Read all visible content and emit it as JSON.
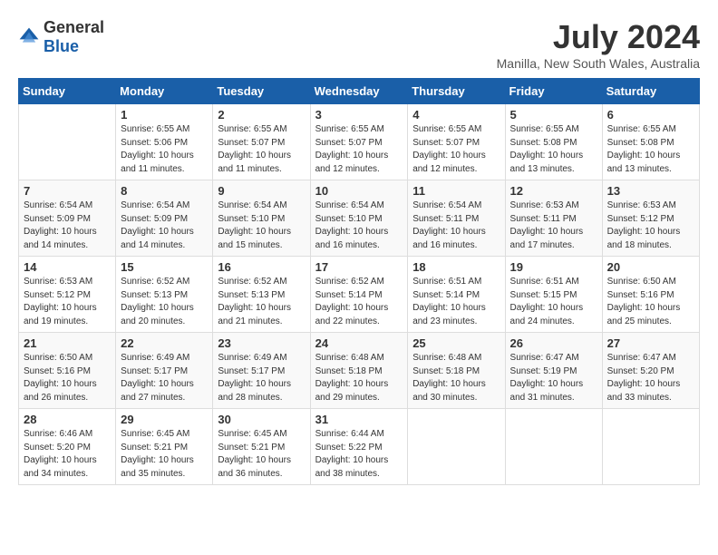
{
  "logo": {
    "general": "General",
    "blue": "Blue"
  },
  "title": {
    "month": "July 2024",
    "location": "Manilla, New South Wales, Australia"
  },
  "days_of_week": [
    "Sunday",
    "Monday",
    "Tuesday",
    "Wednesday",
    "Thursday",
    "Friday",
    "Saturday"
  ],
  "weeks": [
    [
      {
        "day": "",
        "content": ""
      },
      {
        "day": "1",
        "content": "Sunrise: 6:55 AM\nSunset: 5:06 PM\nDaylight: 10 hours\nand 11 minutes."
      },
      {
        "day": "2",
        "content": "Sunrise: 6:55 AM\nSunset: 5:07 PM\nDaylight: 10 hours\nand 11 minutes."
      },
      {
        "day": "3",
        "content": "Sunrise: 6:55 AM\nSunset: 5:07 PM\nDaylight: 10 hours\nand 12 minutes."
      },
      {
        "day": "4",
        "content": "Sunrise: 6:55 AM\nSunset: 5:07 PM\nDaylight: 10 hours\nand 12 minutes."
      },
      {
        "day": "5",
        "content": "Sunrise: 6:55 AM\nSunset: 5:08 PM\nDaylight: 10 hours\nand 13 minutes."
      },
      {
        "day": "6",
        "content": "Sunrise: 6:55 AM\nSunset: 5:08 PM\nDaylight: 10 hours\nand 13 minutes."
      }
    ],
    [
      {
        "day": "7",
        "content": "Sunrise: 6:54 AM\nSunset: 5:09 PM\nDaylight: 10 hours\nand 14 minutes."
      },
      {
        "day": "8",
        "content": "Sunrise: 6:54 AM\nSunset: 5:09 PM\nDaylight: 10 hours\nand 14 minutes."
      },
      {
        "day": "9",
        "content": "Sunrise: 6:54 AM\nSunset: 5:10 PM\nDaylight: 10 hours\nand 15 minutes."
      },
      {
        "day": "10",
        "content": "Sunrise: 6:54 AM\nSunset: 5:10 PM\nDaylight: 10 hours\nand 16 minutes."
      },
      {
        "day": "11",
        "content": "Sunrise: 6:54 AM\nSunset: 5:11 PM\nDaylight: 10 hours\nand 16 minutes."
      },
      {
        "day": "12",
        "content": "Sunrise: 6:53 AM\nSunset: 5:11 PM\nDaylight: 10 hours\nand 17 minutes."
      },
      {
        "day": "13",
        "content": "Sunrise: 6:53 AM\nSunset: 5:12 PM\nDaylight: 10 hours\nand 18 minutes."
      }
    ],
    [
      {
        "day": "14",
        "content": "Sunrise: 6:53 AM\nSunset: 5:12 PM\nDaylight: 10 hours\nand 19 minutes."
      },
      {
        "day": "15",
        "content": "Sunrise: 6:52 AM\nSunset: 5:13 PM\nDaylight: 10 hours\nand 20 minutes."
      },
      {
        "day": "16",
        "content": "Sunrise: 6:52 AM\nSunset: 5:13 PM\nDaylight: 10 hours\nand 21 minutes."
      },
      {
        "day": "17",
        "content": "Sunrise: 6:52 AM\nSunset: 5:14 PM\nDaylight: 10 hours\nand 22 minutes."
      },
      {
        "day": "18",
        "content": "Sunrise: 6:51 AM\nSunset: 5:14 PM\nDaylight: 10 hours\nand 23 minutes."
      },
      {
        "day": "19",
        "content": "Sunrise: 6:51 AM\nSunset: 5:15 PM\nDaylight: 10 hours\nand 24 minutes."
      },
      {
        "day": "20",
        "content": "Sunrise: 6:50 AM\nSunset: 5:16 PM\nDaylight: 10 hours\nand 25 minutes."
      }
    ],
    [
      {
        "day": "21",
        "content": "Sunrise: 6:50 AM\nSunset: 5:16 PM\nDaylight: 10 hours\nand 26 minutes."
      },
      {
        "day": "22",
        "content": "Sunrise: 6:49 AM\nSunset: 5:17 PM\nDaylight: 10 hours\nand 27 minutes."
      },
      {
        "day": "23",
        "content": "Sunrise: 6:49 AM\nSunset: 5:17 PM\nDaylight: 10 hours\nand 28 minutes."
      },
      {
        "day": "24",
        "content": "Sunrise: 6:48 AM\nSunset: 5:18 PM\nDaylight: 10 hours\nand 29 minutes."
      },
      {
        "day": "25",
        "content": "Sunrise: 6:48 AM\nSunset: 5:18 PM\nDaylight: 10 hours\nand 30 minutes."
      },
      {
        "day": "26",
        "content": "Sunrise: 6:47 AM\nSunset: 5:19 PM\nDaylight: 10 hours\nand 31 minutes."
      },
      {
        "day": "27",
        "content": "Sunrise: 6:47 AM\nSunset: 5:20 PM\nDaylight: 10 hours\nand 33 minutes."
      }
    ],
    [
      {
        "day": "28",
        "content": "Sunrise: 6:46 AM\nSunset: 5:20 PM\nDaylight: 10 hours\nand 34 minutes."
      },
      {
        "day": "29",
        "content": "Sunrise: 6:45 AM\nSunset: 5:21 PM\nDaylight: 10 hours\nand 35 minutes."
      },
      {
        "day": "30",
        "content": "Sunrise: 6:45 AM\nSunset: 5:21 PM\nDaylight: 10 hours\nand 36 minutes."
      },
      {
        "day": "31",
        "content": "Sunrise: 6:44 AM\nSunset: 5:22 PM\nDaylight: 10 hours\nand 38 minutes."
      },
      {
        "day": "",
        "content": ""
      },
      {
        "day": "",
        "content": ""
      },
      {
        "day": "",
        "content": ""
      }
    ]
  ]
}
